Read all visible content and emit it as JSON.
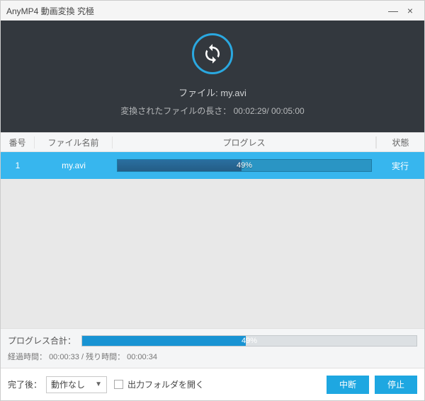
{
  "window": {
    "title": "AnyMP4 動画変換 究極"
  },
  "header": {
    "file_prefix": "ファイル: ",
    "file_name": "my.avi",
    "duration_prefix": "変換されたファイルの長さ：",
    "elapsed": "00:02:29",
    "sep": "/ ",
    "total": "00:05:00"
  },
  "columns": {
    "idx": "番号",
    "name": "ファイル名前",
    "progress": "プログレス",
    "status": "状態"
  },
  "rows": [
    {
      "idx": "1",
      "name": "my.avi",
      "percent": 49,
      "percent_label": "49%",
      "status": "実行"
    }
  ],
  "total": {
    "label": "プログレス合計：",
    "percent": 49,
    "percent_label": "49%",
    "time_label_elapsed": "経過時間：",
    "elapsed": "00:00:33",
    "time_sep": " /",
    "time_label_remain": "残り時間：",
    "remain": "00:00:34"
  },
  "footer": {
    "after_label": "完了後：",
    "after_value": "動作なし",
    "open_folder": "出力フォルダを開く",
    "abort": "中断",
    "stop": "停止"
  }
}
